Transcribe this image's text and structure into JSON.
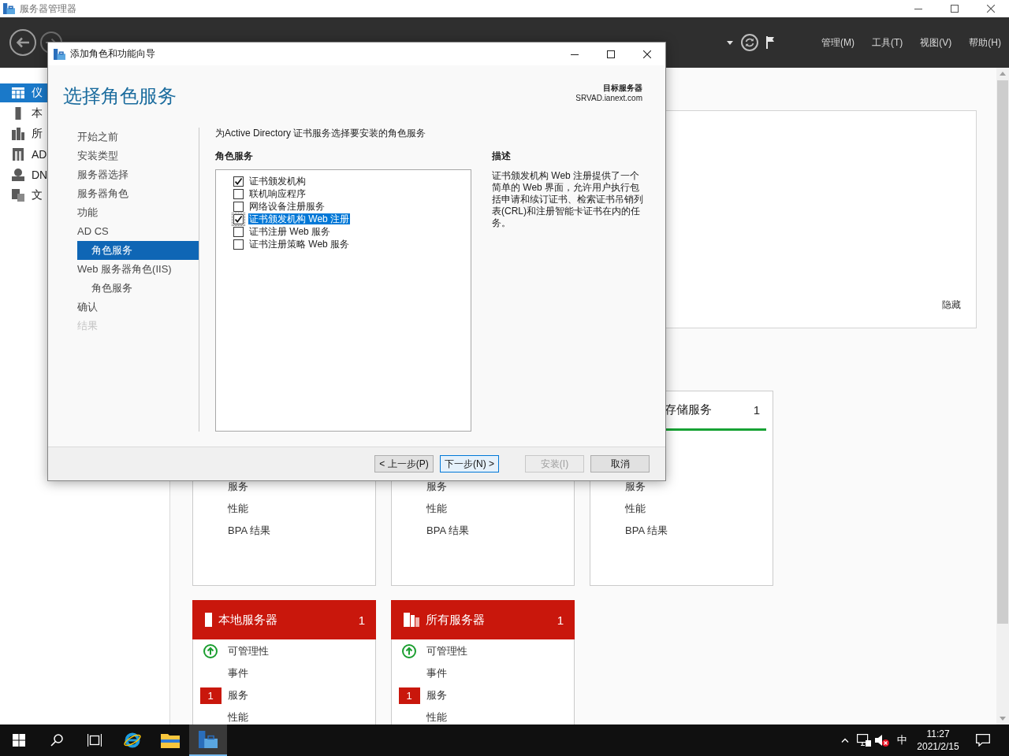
{
  "window": {
    "title": "服务器管理器"
  },
  "header": {
    "menu": [
      "管理(M)",
      "工具(T)",
      "视图(V)",
      "帮助(H)"
    ]
  },
  "sidebar": {
    "items": [
      {
        "label": "仪",
        "selected": true
      },
      {
        "label": "本",
        "selected": false
      },
      {
        "label": "所",
        "selected": false
      },
      {
        "label": "AD",
        "selected": false
      },
      {
        "label": "DN",
        "selected": false
      },
      {
        "label": "文",
        "selected": false
      }
    ]
  },
  "welcome_panel": {
    "hide_link": "隐藏"
  },
  "tiles": [
    {
      "kind": "plain",
      "rows": [
        {
          "label": "服务",
          "kind": "plain"
        },
        {
          "label": "性能",
          "kind": "plain"
        },
        {
          "label": "BPA 结果",
          "kind": "plain"
        }
      ]
    },
    {
      "kind": "plain",
      "rows": [
        {
          "label": "服务",
          "kind": "plain"
        },
        {
          "label": "性能",
          "kind": "plain"
        },
        {
          "label": "BPA 结果",
          "kind": "plain"
        }
      ]
    },
    {
      "kind": "ok",
      "title": "存储服务",
      "count": "1",
      "rows": [
        {
          "label": "服务",
          "kind": "plain"
        },
        {
          "label": "性能",
          "kind": "plain"
        },
        {
          "label": "BPA 结果",
          "kind": "plain"
        }
      ]
    },
    {
      "kind": "alert",
      "title": "本地服务器",
      "count": "1",
      "rows": [
        {
          "label": "可管理性",
          "kind": "ok"
        },
        {
          "label": "事件",
          "kind": "plain"
        },
        {
          "label": "服务",
          "kind": "alert",
          "badge": "1"
        },
        {
          "label": "性能",
          "kind": "plain"
        }
      ]
    },
    {
      "kind": "alert",
      "title": "所有服务器",
      "count": "1",
      "rows": [
        {
          "label": "可管理性",
          "kind": "ok"
        },
        {
          "label": "事件",
          "kind": "plain"
        },
        {
          "label": "服务",
          "kind": "alert",
          "badge": "1"
        },
        {
          "label": "性能",
          "kind": "plain"
        }
      ]
    }
  ],
  "dialog": {
    "title": "添加角色和功能向导",
    "heading": "选择角色服务",
    "target_server": {
      "label": "目标服务器",
      "value": "SRVAD.ianext.com"
    },
    "steps": [
      {
        "label": "开始之前",
        "selected": false,
        "disabled": false
      },
      {
        "label": "安装类型",
        "selected": false,
        "disabled": false
      },
      {
        "label": "服务器选择",
        "selected": false,
        "disabled": false
      },
      {
        "label": "服务器角色",
        "selected": false,
        "disabled": false
      },
      {
        "label": "功能",
        "selected": false,
        "disabled": false
      },
      {
        "label": "AD CS",
        "selected": false,
        "disabled": false,
        "children": [
          {
            "label": "角色服务",
            "selected": true,
            "disabled": false
          }
        ]
      },
      {
        "label": "Web 服务器角色(IIS)",
        "selected": false,
        "disabled": false,
        "children": [
          {
            "label": "角色服务",
            "selected": false,
            "disabled": false
          }
        ]
      },
      {
        "label": "确认",
        "selected": false,
        "disabled": false
      },
      {
        "label": "结果",
        "selected": false,
        "disabled": true
      }
    ],
    "intro": "为Active Directory 证书服务选择要安装的角色服务",
    "roles_heading": "角色服务",
    "roles": [
      {
        "label": "证书颁发机构",
        "checked": true,
        "selected": false
      },
      {
        "label": "联机响应程序",
        "checked": false,
        "selected": false
      },
      {
        "label": "网络设备注册服务",
        "checked": false,
        "selected": false
      },
      {
        "label": "证书颁发机构 Web 注册",
        "checked": true,
        "selected": true
      },
      {
        "label": "证书注册 Web 服务",
        "checked": false,
        "selected": false
      },
      {
        "label": "证书注册策略 Web 服务",
        "checked": false,
        "selected": false
      }
    ],
    "description": {
      "heading": "描述",
      "text": "证书颁发机构 Web 注册提供了一个简单的 Web 界面，允许用户执行包括申请和续订证书、检索证书吊销列表(CRL)和注册智能卡证书在内的任务。"
    },
    "buttons": [
      {
        "label": "< 上一步(P)",
        "disabled": false,
        "focused": false
      },
      {
        "label": "下一步(N) >",
        "disabled": false,
        "focused": true
      },
      {
        "label": "安装(I)",
        "disabled": true,
        "focused": false
      },
      {
        "label": "取消",
        "disabled": false,
        "focused": false
      }
    ]
  },
  "taskbar": {
    "apps": [
      {
        "selected": false
      },
      {
        "selected": false
      },
      {
        "selected": true
      }
    ],
    "tray": {
      "ime": "中",
      "time": "11:27",
      "date": "2021/2/15"
    }
  }
}
